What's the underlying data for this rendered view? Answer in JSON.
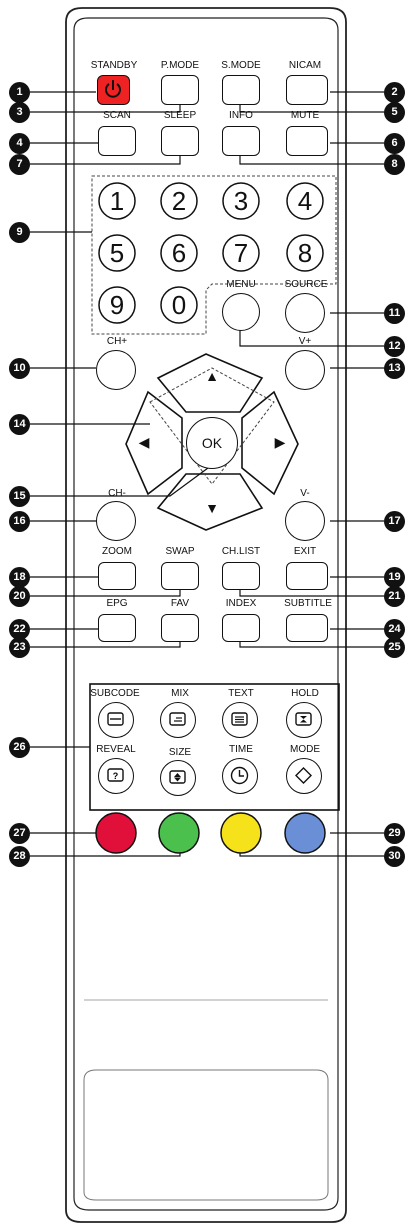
{
  "labels": {
    "standby": "STANDBY",
    "pmode": "P.MODE",
    "smode": "S.MODE",
    "nicam": "NICAM",
    "scan": "SCAN",
    "sleep": "SLEEP",
    "info": "INFO",
    "mute": "MUTE",
    "menu": "MENU",
    "source": "SOURCE",
    "chplus": "CH+",
    "vplus": "V+",
    "ok": "OK",
    "chminus": "CH-",
    "vminus": "V-",
    "zoom": "ZOOM",
    "swap": "SWAP",
    "chlist": "CH.LIST",
    "exit": "EXIT",
    "epg": "EPG",
    "fav": "FAV",
    "index": "INDEX",
    "subtitle": "SUBTITLE",
    "subcode": "SUBCODE",
    "mix": "MIX",
    "text": "TEXT",
    "hold": "HOLD",
    "reveal": "REVEAL",
    "size": "SIZE",
    "time": "TIME",
    "mode": "MODE"
  },
  "digits": [
    "1",
    "2",
    "3",
    "4",
    "5",
    "6",
    "7",
    "8",
    "9",
    "0"
  ],
  "callouts": [
    "1",
    "2",
    "3",
    "4",
    "5",
    "6",
    "7",
    "8",
    "9",
    "10",
    "11",
    "12",
    "13",
    "14",
    "15",
    "16",
    "17",
    "18",
    "19",
    "20",
    "21",
    "22",
    "23",
    "24",
    "25",
    "26",
    "27",
    "28",
    "29",
    "30"
  ],
  "color_keys": {
    "red": "#e0103a",
    "green": "#4cc04c",
    "yellow": "#f5e21a",
    "blue": "#6b8fd6"
  },
  "arrows": {
    "up": "▲",
    "down": "▼",
    "left": "◀",
    "right": "▶"
  }
}
